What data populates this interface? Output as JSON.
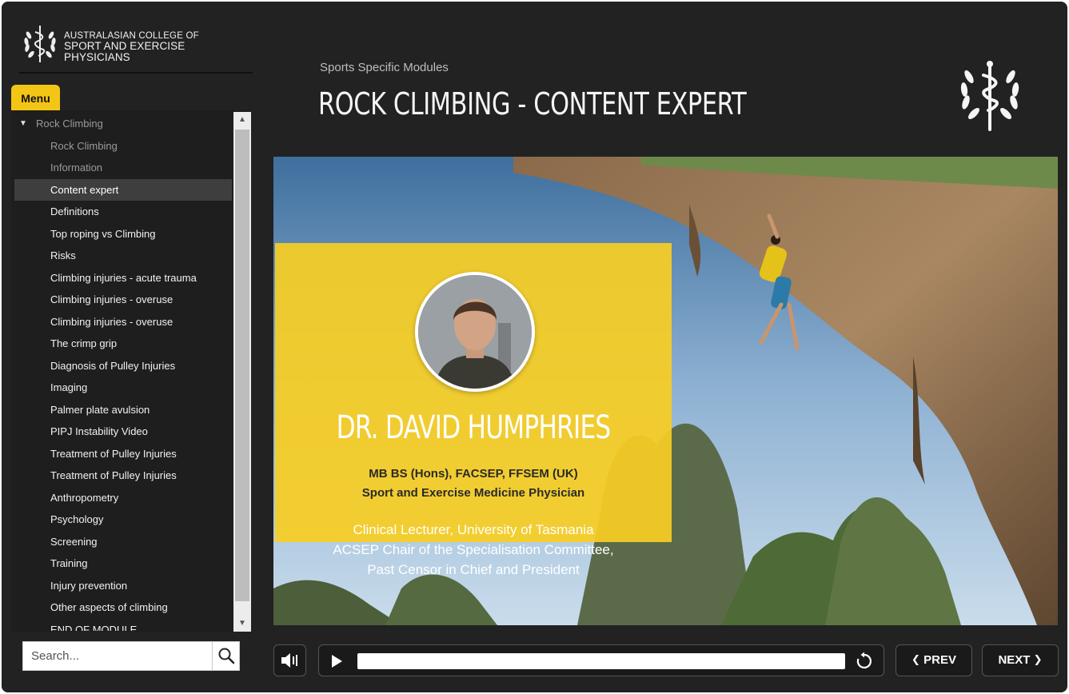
{
  "brand": {
    "line1": "AUSTRALASIAN COLLEGE OF",
    "line2": "SPORT AND EXERCISE PHYSICIANS"
  },
  "menu": {
    "tab_label": "Menu",
    "items": [
      {
        "label": "Rock Climbing",
        "kind": "section"
      },
      {
        "label": "Rock Climbing",
        "kind": "dim"
      },
      {
        "label": "Information",
        "kind": "dim"
      },
      {
        "label": "Content expert",
        "kind": "active"
      },
      {
        "label": "Definitions",
        "kind": "normal"
      },
      {
        "label": "Top roping vs Climbing",
        "kind": "normal"
      },
      {
        "label": "Risks",
        "kind": "normal"
      },
      {
        "label": "Climbing injuries - acute trauma",
        "kind": "normal"
      },
      {
        "label": "Climbing injuries - overuse",
        "kind": "normal"
      },
      {
        "label": "Climbing injuries - overuse",
        "kind": "normal"
      },
      {
        "label": "The crimp grip",
        "kind": "normal"
      },
      {
        "label": "Diagnosis of Pulley Injuries",
        "kind": "normal"
      },
      {
        "label": "Imaging",
        "kind": "normal"
      },
      {
        "label": "Palmer plate avulsion",
        "kind": "normal"
      },
      {
        "label": "PIPJ Instability Video",
        "kind": "normal"
      },
      {
        "label": "Treatment of Pulley Injuries",
        "kind": "normal"
      },
      {
        "label": "Treatment of Pulley Injuries",
        "kind": "normal"
      },
      {
        "label": "Anthropometry",
        "kind": "normal"
      },
      {
        "label": "Psychology",
        "kind": "normal"
      },
      {
        "label": "Screening",
        "kind": "normal"
      },
      {
        "label": "Training",
        "kind": "normal"
      },
      {
        "label": "Injury prevention",
        "kind": "normal"
      },
      {
        "label": "Other aspects of climbing",
        "kind": "normal"
      },
      {
        "label": "END OF MODULE",
        "kind": "normal"
      }
    ]
  },
  "search": {
    "placeholder": "Search...",
    "icon": "search-icon"
  },
  "header": {
    "breadcrumb": "Sports Specific Modules",
    "title": "ROCK CLIMBING - CONTENT EXPERT"
  },
  "slide": {
    "name": "DR. DAVID HUMPHRIES",
    "qualifications": "MB BS (Hons), FACSEP, FFSEM (UK)",
    "specialty": "Sport and Exercise Medicine Physician",
    "roles": [
      "Clinical Lecturer, University of Tasmania",
      "ACSEP Chair of the Specialisation Committee,",
      "Past Censor in Chief and President"
    ]
  },
  "player": {
    "progress": 0,
    "prev_label": "PREV",
    "next_label": "NEXT",
    "icons": [
      "audio-icon",
      "play-icon",
      "replay-icon",
      "chevron-left-icon",
      "chevron-right-icon"
    ]
  },
  "colors": {
    "accent": "#f3c515",
    "background": "#222222",
    "card": "#f6ce23"
  }
}
